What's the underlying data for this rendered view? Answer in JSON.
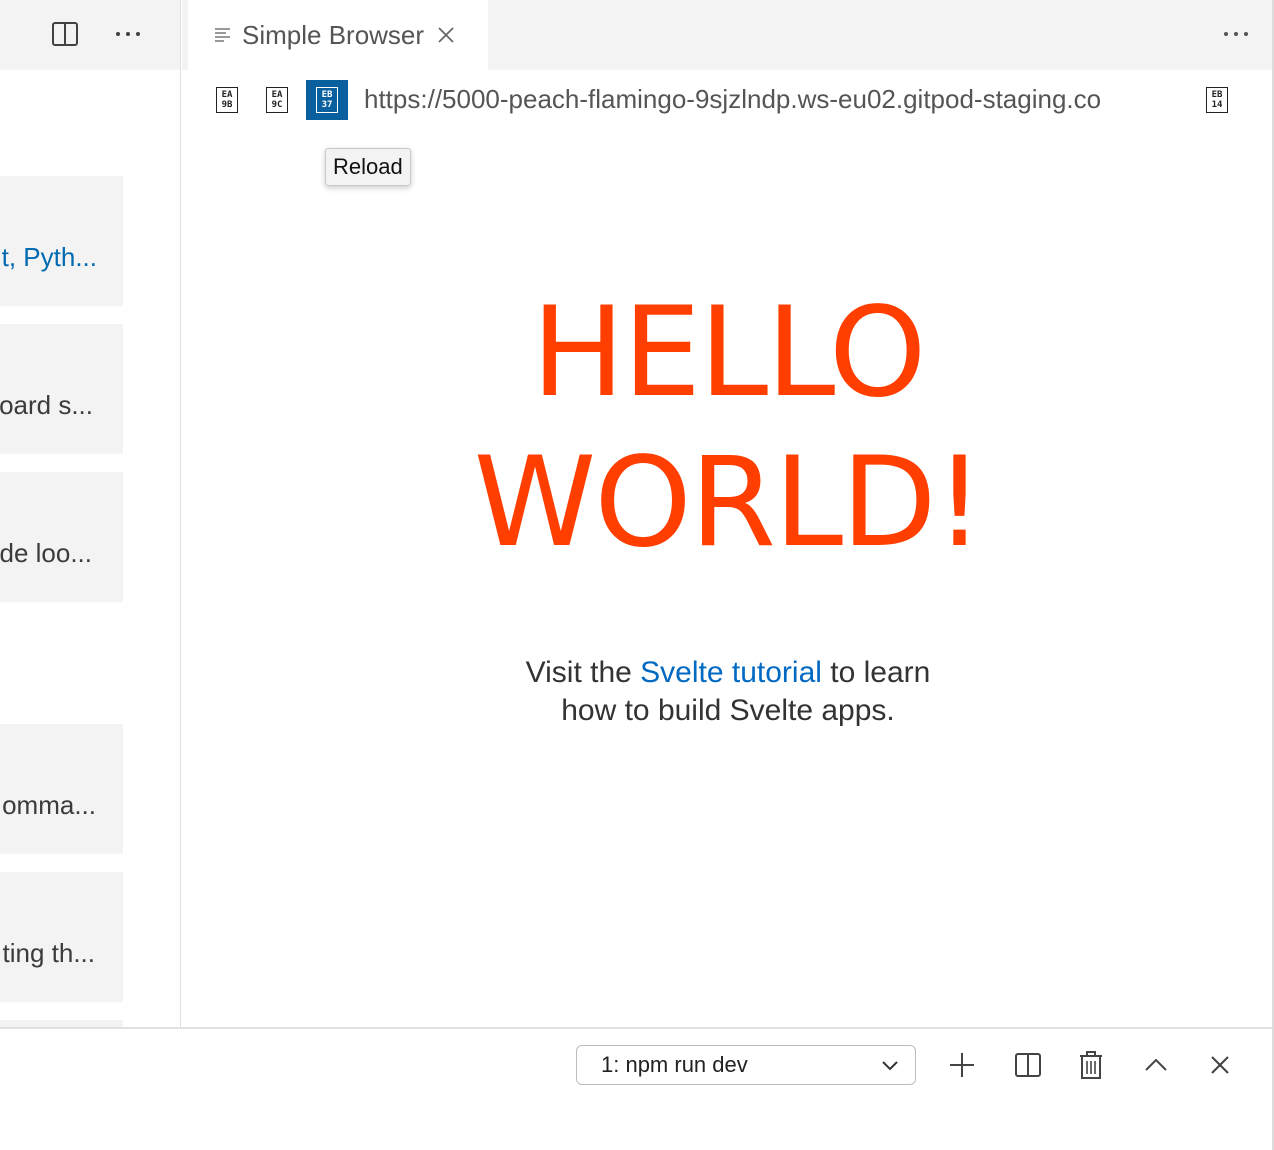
{
  "left_header": {
    "icons": [
      "split-editor-icon",
      "more-actions-icon"
    ]
  },
  "sidebar_cards": [
    {
      "text": "t, Pyth...",
      "is_link": true
    },
    {
      "text": "oard s..."
    },
    {
      "text": "de loo..."
    },
    {
      "text": "omma..."
    },
    {
      "text": "ting th..."
    }
  ],
  "tab": {
    "title": "Simple Browser",
    "icon": "preview-lines-icon",
    "close_icon": "close-icon"
  },
  "tab_bar": {
    "more_icon": "more-actions-icon"
  },
  "browser": {
    "back_glyph": [
      "EA",
      "9B"
    ],
    "forward_glyph": [
      "EA",
      "9C"
    ],
    "reload_glyph": [
      "EB",
      "37"
    ],
    "url": "https://5000-peach-flamingo-9sjzlndp.ws-eu02.gitpod-staging.co",
    "open_glyph": [
      "EB",
      "14"
    ],
    "tooltip": "Reload"
  },
  "page": {
    "heading_line1": "HELLO",
    "heading_line2": "WORLD!",
    "visit_prefix": "Visit the ",
    "visit_link": "Svelte tutorial",
    "visit_suffix1": " to learn",
    "visit_line2": "how to build Svelte apps.",
    "heading_color": "#ff3e00",
    "link_color": "#0069c2"
  },
  "panel": {
    "terminal_selected": "1: npm run dev",
    "buttons": [
      "add-icon",
      "split-icon",
      "trash-icon",
      "chevron-up-icon",
      "close-icon"
    ]
  }
}
